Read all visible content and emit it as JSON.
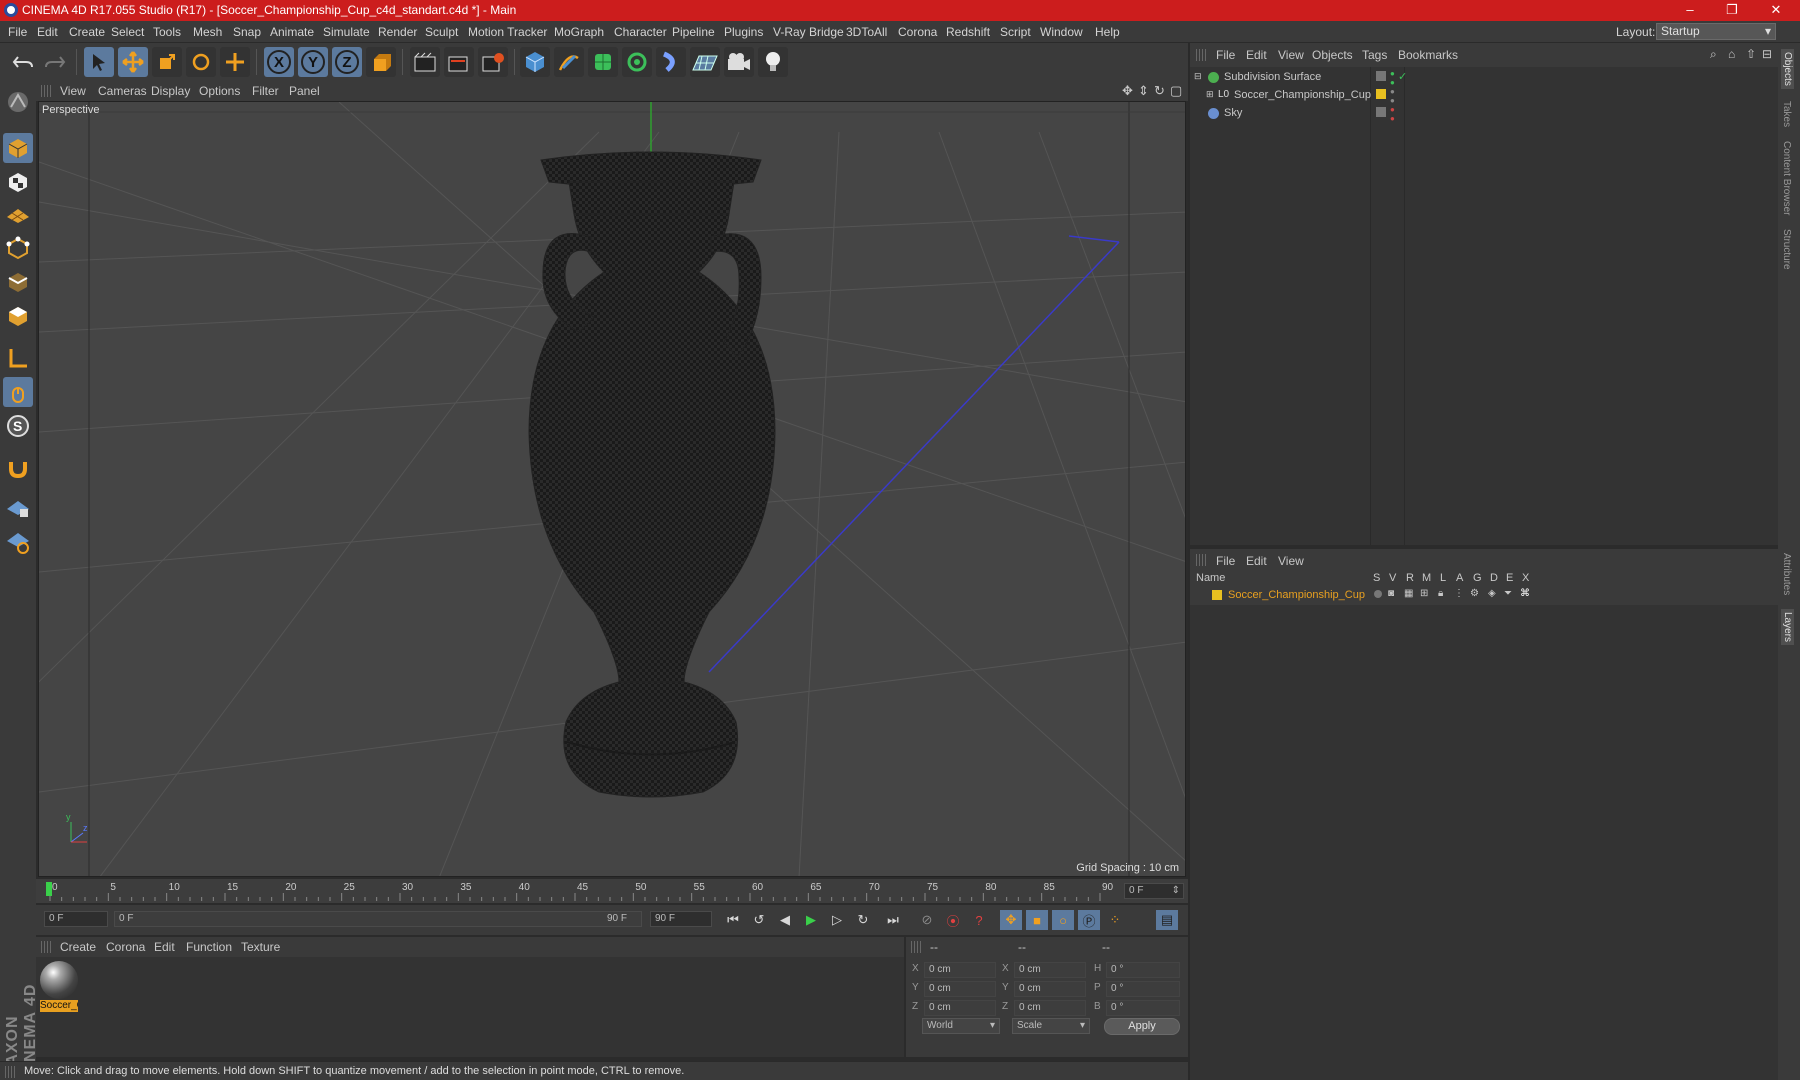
{
  "window": {
    "title": "CINEMA 4D R17.055 Studio (R17) - [Soccer_Championship_Cup_c4d_standart.c4d *] - Main",
    "controls": {
      "minimize": "–",
      "restore": "❐",
      "close": "✕"
    }
  },
  "menubar": {
    "items": [
      "File",
      "Edit",
      "Create",
      "Select",
      "Tools",
      "Mesh",
      "Snap",
      "Animate",
      "Simulate",
      "Render",
      "Sculpt",
      "Motion Tracker",
      "MoGraph",
      "Character",
      "Pipeline",
      "Plugins",
      "V-Ray Bridge",
      "3DToAll",
      "Corona",
      "Redshift",
      "Script",
      "Window",
      "Help"
    ],
    "layout_label": "Layout:",
    "layout_value": "Startup"
  },
  "toolbar": {
    "axis_labels": [
      "X",
      "Y",
      "Z"
    ],
    "icons": [
      "undo-icon",
      "redo-icon",
      "select-icon",
      "move-icon",
      "scale-icon",
      "rotate-icon",
      "transform-icon",
      "x-axis-icon",
      "y-axis-icon",
      "z-axis-icon",
      "coordinate-system-icon",
      "render-view-icon",
      "render-picture-viewer-icon",
      "render-settings-icon",
      "cube-icon",
      "pen-icon",
      "subdivision-icon",
      "cloner-icon",
      "deformer-icon",
      "floor-icon",
      "camera-icon",
      "light-icon"
    ]
  },
  "viewport": {
    "menu": [
      "View",
      "Cameras",
      "Display",
      "Options",
      "Filter",
      "Panel"
    ],
    "label": "Perspective",
    "grid_spacing": "Grid Spacing : 10 cm"
  },
  "timeline": {
    "ticks": [
      "0",
      "5",
      "10",
      "15",
      "20",
      "25",
      "30",
      "35",
      "40",
      "45",
      "50",
      "55",
      "60",
      "65",
      "70",
      "75",
      "80",
      "85",
      "90"
    ],
    "current_frame": "0 F",
    "start_field": "0 F",
    "range_start": "0 F",
    "range_end": "90 F",
    "end_field": "90 F"
  },
  "material_manager": {
    "menu": [
      "Create",
      "Corona",
      "Edit",
      "Function",
      "Texture"
    ],
    "materials": [
      {
        "label": "Soccer_C"
      }
    ]
  },
  "coordinates": {
    "header": [
      "--",
      "--",
      "--"
    ],
    "rows": [
      {
        "a": "X",
        "v1": "0 cm",
        "b": "X",
        "v2": "0 cm",
        "c": "H",
        "v3": "0 °"
      },
      {
        "a": "Y",
        "v1": "0 cm",
        "b": "Y",
        "v2": "0 cm",
        "c": "P",
        "v3": "0 °"
      },
      {
        "a": "Z",
        "v1": "0 cm",
        "b": "Z",
        "v2": "0 cm",
        "c": "B",
        "v3": "0 °"
      }
    ],
    "world": "World",
    "scale": "Scale",
    "apply": "Apply"
  },
  "status": "Move: Click and drag to move elements. Hold down SHIFT to quantize movement / add to the selection in point mode, CTRL to remove.",
  "object_manager": {
    "menu": [
      "File",
      "Edit",
      "View",
      "Objects",
      "Tags",
      "Bookmarks"
    ],
    "objects": [
      {
        "name": "Subdivision Surface",
        "color": "#4caf50"
      },
      {
        "name": "Soccer_Championship_Cup",
        "color": "#e8c020"
      },
      {
        "name": "Sky",
        "color": "#6a8fd0"
      }
    ]
  },
  "layer_manager": {
    "menu": [
      "File",
      "Edit",
      "View"
    ],
    "columns": [
      "Name",
      "S",
      "V",
      "R",
      "M",
      "L",
      "A",
      "G",
      "D",
      "E",
      "X"
    ],
    "layers": [
      {
        "name": "Soccer_Championship_Cup",
        "color": "#e8c020"
      }
    ]
  },
  "right_tabs": [
    "Objects",
    "Takes",
    "Content Browser",
    "Structure",
    "Attributes",
    "Layers"
  ],
  "brand": "MAXON CINEMA 4D",
  "colors": {
    "accent": "#cc1d1d",
    "tool_active": "#5c7a9e",
    "selected_text": "#e8a020"
  }
}
